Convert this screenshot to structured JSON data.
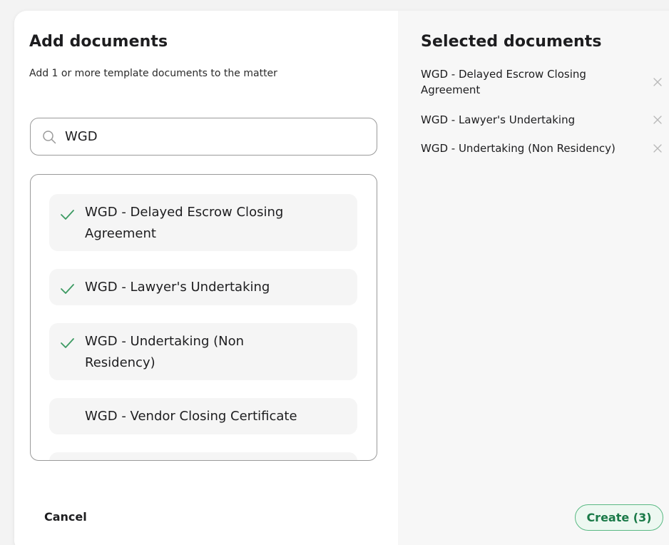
{
  "left": {
    "title": "Add documents",
    "subtitle": "Add 1 or more template documents to the matter",
    "search": {
      "value": "WGD",
      "placeholder": ""
    },
    "results": [
      {
        "label": "WGD - Delayed Escrow Closing Agreement",
        "checked": true
      },
      {
        "label": "WGD - Lawyer's Undertaking",
        "checked": true
      },
      {
        "label": "WGD - Undertaking (Non Residency)",
        "checked": true
      },
      {
        "label": "WGD - Vendor Closing Certificate",
        "checked": false
      }
    ]
  },
  "right": {
    "title": "Selected documents",
    "selected": [
      {
        "label": "WGD - Delayed Escrow Closing Agreement"
      },
      {
        "label": "WGD - Lawyer's Undertaking"
      },
      {
        "label": "WGD - Undertaking (Non Residency)"
      }
    ]
  },
  "footer": {
    "cancel_label": "Cancel",
    "create_label": "Create (3)"
  },
  "colors": {
    "check": "#3c9a62",
    "accent_border": "#59b983",
    "accent_bg": "#edf8f1",
    "accent_text": "#1a7a48"
  },
  "icons": {
    "search": "search-icon",
    "check": "check-icon",
    "close": "close-icon"
  }
}
